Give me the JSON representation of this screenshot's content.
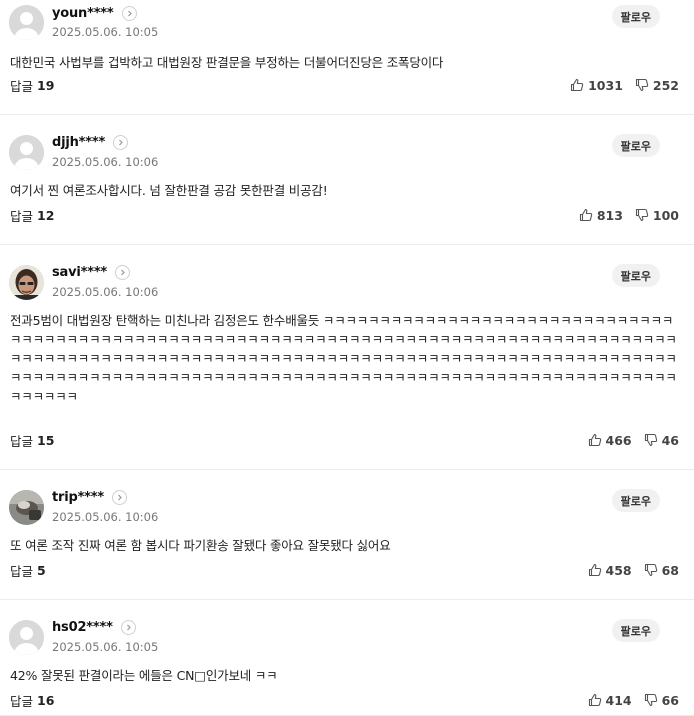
{
  "ui": {
    "follow_label": "팔로우",
    "reply_label": "답글"
  },
  "comments": [
    {
      "nickname": "youn****",
      "date": "2025.05.06. 10:05",
      "text": "대한민국 사법부를 겁박하고 대법원장 판결문을 부정하는 더불어더진당은 조폭당이다",
      "replies": "19",
      "likes": "1031",
      "dislikes": "252",
      "avatar": "default-avatar"
    },
    {
      "nickname": "djjh****",
      "date": "2025.05.06. 10:06",
      "text": "여기서 찐 여론조사합시다. 넘 잘한판결 공감 못한판결 비공감!",
      "replies": "12",
      "likes": "813",
      "dislikes": "100",
      "avatar": "default-avatar"
    },
    {
      "nickname": "savi****",
      "date": "2025.05.06. 10:06",
      "text": "전과5범이 대법원장 탄핵하는 미친나라 김정은도 한수배울듯 ㅋㅋㅋㅋㅋㅋㅋㅋㅋㅋㅋㅋㅋㅋㅋㅋㅋㅋㅋㅋㅋㅋㅋㅋㅋㅋㅋㅋㅋㅋㅋㅋㅋㅋㅋㅋㅋㅋㅋㅋㅋㅋㅋㅋㅋㅋㅋㅋㅋㅋㅋㅋㅋㅋㅋㅋㅋㅋㅋㅋㅋㅋㅋㅋㅋㅋㅋㅋㅋㅋㅋㅋㅋㅋㅋㅋㅋㅋㅋㅋㅋㅋㅋㅋㅋㅋㅋㅋㅋㅋㅋㅋㅋㅋㅋㅋㅋㅋㅋㅋㅋㅋㅋㅋㅋㅋㅋㅋㅋㅋㅋㅋㅋㅋㅋㅋㅋㅋㅋㅋㅋㅋㅋㅋㅋㅋㅋㅋㅋㅋㅋㅋㅋㅋㅋㅋㅋㅋㅋㅋㅋㅋㅋㅋㅋㅋㅋㅋㅋㅋㅋㅋㅋㅋㅋㅋㅋㅋㅋㅋㅋㅋㅋㅋㅋㅋㅋㅋㅋㅋㅋㅋㅋㅋㅋㅋㅋㅋㅋㅋㅋㅋㅋㅋㅋㅋㅋㅋㅋㅋㅋㅋㅋㅋㅋㅋㅋㅋㅋㅋㅋㅋㅋㅋㅋㅋㅋㅋㅋㅋㅋㅋㅋㅋ",
      "replies": "15",
      "likes": "466",
      "dislikes": "46",
      "avatar": "photo-avatar-face"
    },
    {
      "nickname": "trip****",
      "date": "2025.05.06. 10:06",
      "text": "또 여론 조작 진짜 여론 함 봅시다 파기환송 잘됐다 좋아요 잘못됐다 싫어요",
      "replies": "5",
      "likes": "458",
      "dislikes": "68",
      "avatar": "photo-avatar-object"
    },
    {
      "nickname": "hs02****",
      "date": "2025.05.06. 10:05",
      "text": "42% 잘못된 판결이라는 에들은 CN□인가보네 ㅋㅋ",
      "replies": "16",
      "likes": "414",
      "dislikes": "66",
      "avatar": "default-avatar"
    }
  ]
}
